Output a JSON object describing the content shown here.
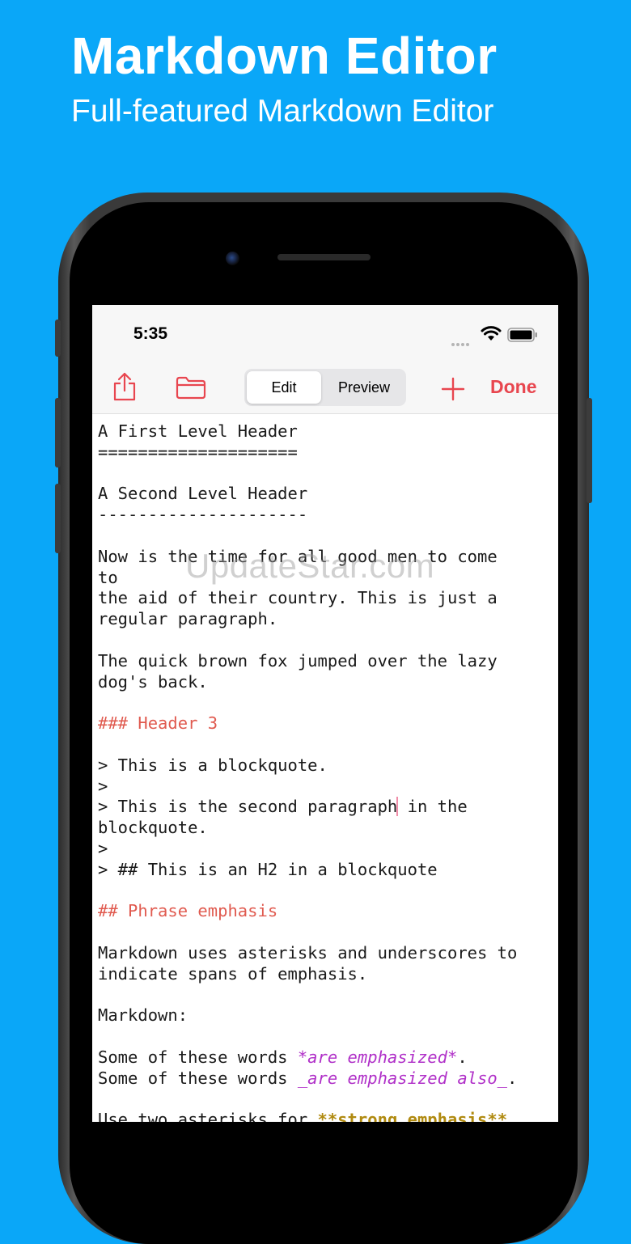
{
  "promo": {
    "title": "Markdown Editor",
    "subtitle": "Full-featured Markdown Editor"
  },
  "status_bar": {
    "time": "5:35"
  },
  "toolbar": {
    "edit_label": "Edit",
    "preview_label": "Preview",
    "done_label": "Done",
    "accent_color": "#e8464f"
  },
  "editor": {
    "lines": [
      "A First Level Header",
      "====================",
      "",
      "A Second Level Header",
      "---------------------",
      "",
      "Now is the time for all good men to come",
      "to",
      "the aid of their country. This is just a",
      "regular paragraph.",
      "",
      "The quick brown fox jumped over the lazy",
      "dog's back.",
      "",
      "### Header 3",
      "",
      "> This is a blockquote.",
      ">",
      "> This is the second paragraph",
      " in the",
      "blockquote.",
      ">",
      "> ## This is an H2 in a blockquote",
      "",
      "## Phrase emphasis",
      "",
      "Markdown uses asterisks and underscores to",
      "indicate spans of emphasis.",
      "",
      "Markdown:",
      "",
      "Some of these words ",
      "*are emphasized*",
      ".",
      "Some of these words ",
      "_are emphasized also_",
      ".",
      "",
      "Use two asterisks for ",
      "**strong emphasis**"
    ]
  },
  "watermark": "UpdateStar.com"
}
